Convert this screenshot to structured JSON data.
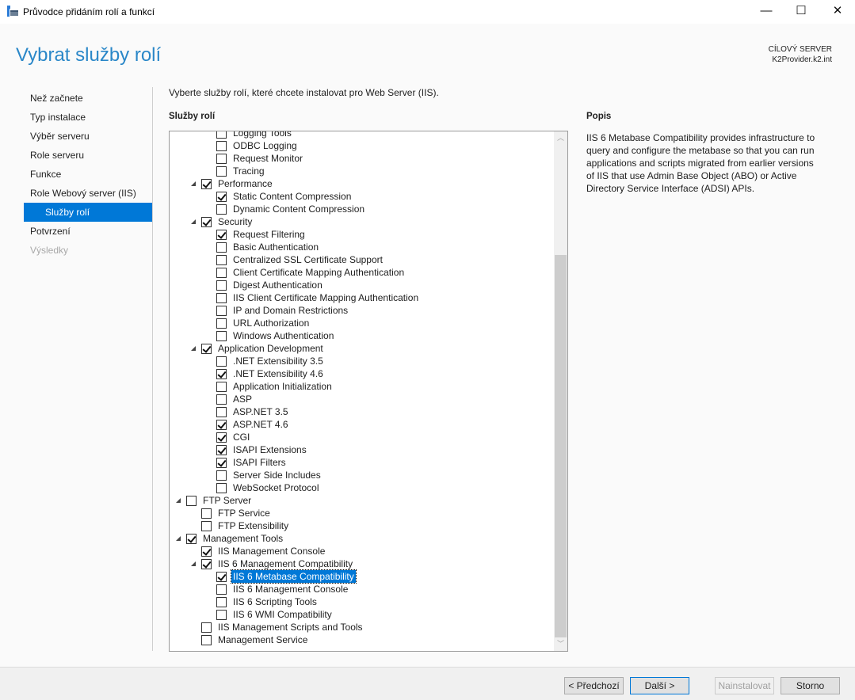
{
  "window": {
    "title": "Průvodce přidáním rolí a funkcí",
    "minimize": "—",
    "maximize": "☐",
    "close": "✕"
  },
  "header": {
    "page_title": "Vybrat služby rolí",
    "dest_label": "CÍLOVÝ SERVER",
    "dest_server": "K2Provider.k2.int"
  },
  "nav": [
    {
      "label": "Než začnete",
      "state": "normal"
    },
    {
      "label": "Typ instalace",
      "state": "normal"
    },
    {
      "label": "Výběr serveru",
      "state": "normal"
    },
    {
      "label": "Role serveru",
      "state": "normal"
    },
    {
      "label": "Funkce",
      "state": "normal"
    },
    {
      "label": "Role Webový server (IIS)",
      "state": "normal"
    },
    {
      "label": "Služby rolí",
      "state": "active"
    },
    {
      "label": "Potvrzení",
      "state": "normal"
    },
    {
      "label": "Výsledky",
      "state": "disabled"
    }
  ],
  "main": {
    "instruction": "Vyberte služby rolí, které chcete instalovat pro Web Server (IIS).",
    "services_label": "Služby rolí",
    "description_label": "Popis",
    "description": "IIS 6 Metabase Compatibility provides infrastructure to query and configure the metabase so that you can run applications and scripts migrated from earlier versions of IIS that use Admin Base Object (ABO) or Active Directory Service Interface (ADSI) APIs.",
    "tree": [
      {
        "label": "Logging Tools",
        "level": 2,
        "checked": false
      },
      {
        "label": "ODBC Logging",
        "level": 2,
        "checked": false
      },
      {
        "label": "Request Monitor",
        "level": 2,
        "checked": false
      },
      {
        "label": "Tracing",
        "level": 2,
        "checked": false
      },
      {
        "label": "Performance",
        "level": 1,
        "checked": true,
        "expanded": true
      },
      {
        "label": "Static Content Compression",
        "level": 2,
        "checked": true
      },
      {
        "label": "Dynamic Content Compression",
        "level": 2,
        "checked": false
      },
      {
        "label": "Security",
        "level": 1,
        "checked": true,
        "expanded": true
      },
      {
        "label": "Request Filtering",
        "level": 2,
        "checked": true
      },
      {
        "label": "Basic Authentication",
        "level": 2,
        "checked": false
      },
      {
        "label": "Centralized SSL Certificate Support",
        "level": 2,
        "checked": false
      },
      {
        "label": "Client Certificate Mapping Authentication",
        "level": 2,
        "checked": false
      },
      {
        "label": "Digest Authentication",
        "level": 2,
        "checked": false
      },
      {
        "label": "IIS Client Certificate Mapping Authentication",
        "level": 2,
        "checked": false
      },
      {
        "label": "IP and Domain Restrictions",
        "level": 2,
        "checked": false
      },
      {
        "label": "URL Authorization",
        "level": 2,
        "checked": false
      },
      {
        "label": "Windows Authentication",
        "level": 2,
        "checked": false
      },
      {
        "label": "Application Development",
        "level": 1,
        "checked": true,
        "expanded": true
      },
      {
        "label": ".NET Extensibility 3.5",
        "level": 2,
        "checked": false
      },
      {
        "label": ".NET Extensibility 4.6",
        "level": 2,
        "checked": true
      },
      {
        "label": "Application Initialization",
        "level": 2,
        "checked": false
      },
      {
        "label": "ASP",
        "level": 2,
        "checked": false
      },
      {
        "label": "ASP.NET 3.5",
        "level": 2,
        "checked": false
      },
      {
        "label": "ASP.NET 4.6",
        "level": 2,
        "checked": true
      },
      {
        "label": "CGI",
        "level": 2,
        "checked": true
      },
      {
        "label": "ISAPI Extensions",
        "level": 2,
        "checked": true
      },
      {
        "label": "ISAPI Filters",
        "level": 2,
        "checked": true
      },
      {
        "label": "Server Side Includes",
        "level": 2,
        "checked": false
      },
      {
        "label": "WebSocket Protocol",
        "level": 2,
        "checked": false
      },
      {
        "label": "FTP Server",
        "level": 0,
        "checked": false,
        "expanded": true
      },
      {
        "label": "FTP Service",
        "level": 1,
        "checked": false
      },
      {
        "label": "FTP Extensibility",
        "level": 1,
        "checked": false
      },
      {
        "label": "Management Tools",
        "level": 0,
        "checked": true,
        "expanded": true
      },
      {
        "label": "IIS Management Console",
        "level": 1,
        "checked": true
      },
      {
        "label": "IIS 6 Management Compatibility",
        "level": 1,
        "checked": true,
        "expanded": true
      },
      {
        "label": "IIS 6 Metabase Compatibility",
        "level": 2,
        "checked": true,
        "selected": true
      },
      {
        "label": "IIS 6 Management Console",
        "level": 2,
        "checked": false
      },
      {
        "label": "IIS 6 Scripting Tools",
        "level": 2,
        "checked": false
      },
      {
        "label": "IIS 6 WMI Compatibility",
        "level": 2,
        "checked": false
      },
      {
        "label": "IIS Management Scripts and Tools",
        "level": 1,
        "checked": false
      },
      {
        "label": "Management Service",
        "level": 1,
        "checked": false
      }
    ]
  },
  "footer": {
    "previous": "< Předchozí",
    "next": "Další >",
    "install": "Nainstalovat",
    "cancel": "Storno"
  },
  "colors": {
    "accent": "#0078d7",
    "title": "#2a87c8"
  }
}
